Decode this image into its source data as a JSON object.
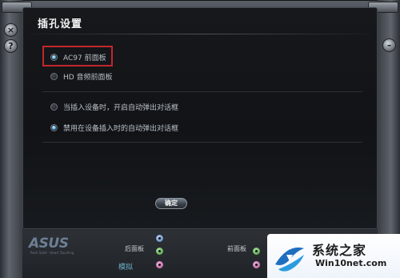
{
  "window": {
    "title": "插孔设置"
  },
  "panel_options": {
    "ac97": {
      "label": "AC97 前面板",
      "selected": true
    },
    "hd": {
      "label": "HD 音频前面板",
      "selected": false
    },
    "popup_on_insert": {
      "label": "当插入设备时，开启自动弹出对话框",
      "selected": false
    },
    "disable_popup": {
      "label": "禁用在设备插入时的自动弹出对话框",
      "selected": true
    }
  },
  "ok_button": {
    "label": "确定"
  },
  "bottom_strip": {
    "brand": "ASUS",
    "tagline": "Rock Solid · Heart Touching",
    "back_panel_label": "后面板",
    "front_panel_label": "前面板",
    "mode_label": "模拟"
  },
  "side_controls": {
    "left_top": "×",
    "left_bottom": "?",
    "right_top": "–"
  },
  "watermark": {
    "title": "系统之家",
    "url": "Win10net.com"
  },
  "colors": {
    "highlight_border": "#c1272d",
    "radio_selected": "#4aa6d8",
    "jack_green": "#3c9a2f",
    "jack_blue": "#4d74b6",
    "jack_pink": "#b04a94"
  }
}
